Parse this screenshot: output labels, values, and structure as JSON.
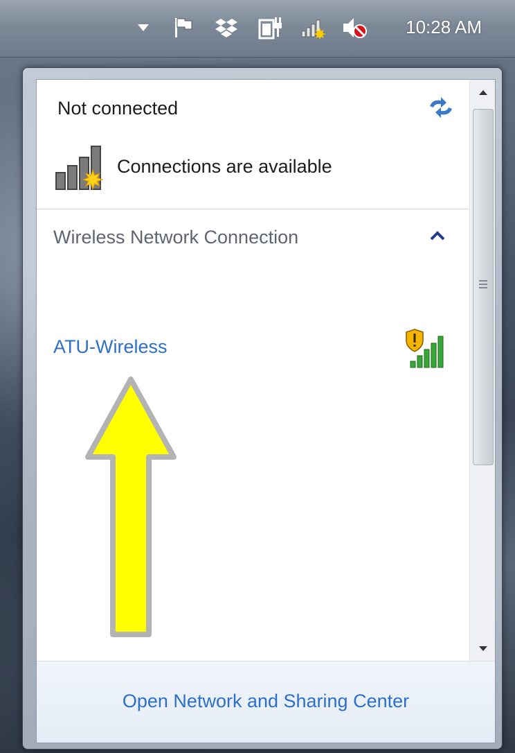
{
  "taskbar": {
    "clock": "10:28 AM",
    "icons": [
      "chevron-down-icon",
      "flag-icon",
      "dropbox-icon",
      "power-icon",
      "network-icon",
      "volume-muted-icon"
    ]
  },
  "flyout": {
    "status": "Not connected",
    "availability": "Connections are available",
    "section_title": "Wireless Network Connection",
    "networks": [
      {
        "name": "ATU-Wireless",
        "secured": false,
        "signal": "full"
      }
    ],
    "footer_link": "Open Network and Sharing Center"
  },
  "colors": {
    "link": "#2e6fc9",
    "section": "#5d6670",
    "signal_green": "#3aa63a",
    "arrow_yellow": "#ffff00"
  }
}
